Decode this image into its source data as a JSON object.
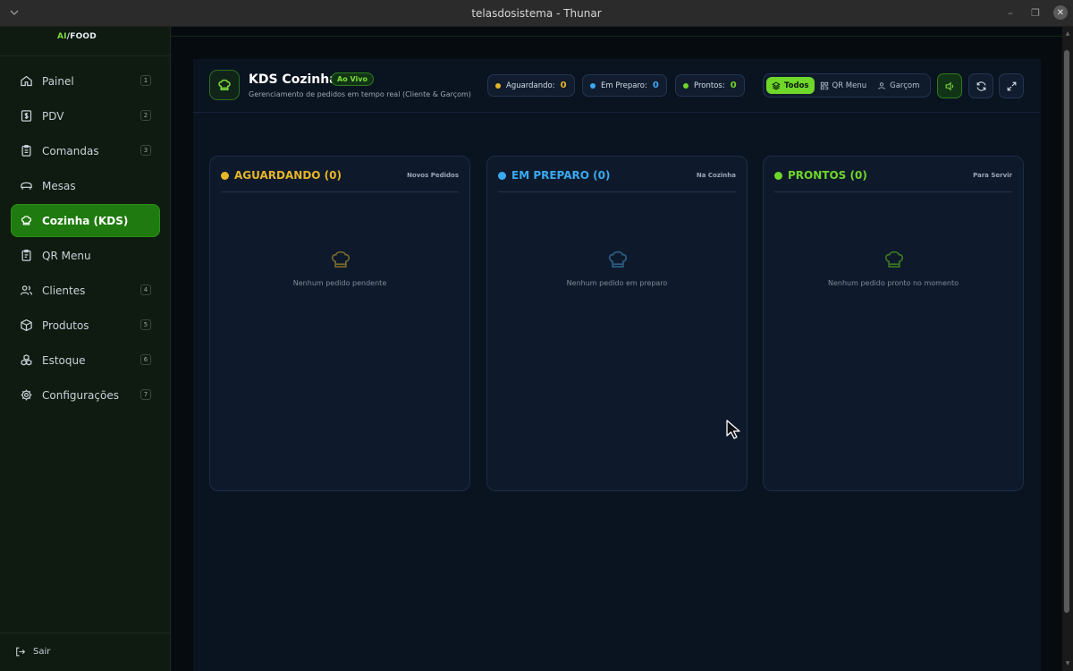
{
  "window": {
    "title": "telasdosistema - Thunar",
    "minimize": "–",
    "maximize": "❐",
    "close": "✕"
  },
  "sidebar": {
    "brand": {
      "ai": "AI",
      "food": "FOOD"
    },
    "items": [
      {
        "label": "Painel",
        "icon": "home-icon",
        "key": "1"
      },
      {
        "label": "PDV",
        "icon": "dollar-icon",
        "key": "2"
      },
      {
        "label": "Comandas",
        "icon": "clipboard-icon",
        "key": "3"
      },
      {
        "label": "Mesas",
        "icon": "table-icon",
        "key": ""
      },
      {
        "label": "Cozinha (KDS)",
        "icon": "chef-hat-icon",
        "key": "",
        "active": true
      },
      {
        "label": "QR Menu",
        "icon": "qr-doc-icon",
        "key": ""
      },
      {
        "label": "Clientes",
        "icon": "users-icon",
        "key": "4"
      },
      {
        "label": "Produtos",
        "icon": "box-icon",
        "key": "5"
      },
      {
        "label": "Estoque",
        "icon": "boxes-icon",
        "key": "6"
      },
      {
        "label": "Configurações",
        "icon": "gear-icon",
        "key": "7"
      }
    ],
    "logout": "Sair"
  },
  "header": {
    "title": "KDS Cozinha",
    "live_badge": "Ao Vivo",
    "subtitle": "Gerenciamento de pedidos em tempo real (Cliente & Garçom)",
    "stats": [
      {
        "label": "Aguardando:",
        "value": "0",
        "color": "#e5b52a"
      },
      {
        "label": "Em Preparo:",
        "value": "0",
        "color": "#3aa9f0"
      },
      {
        "label": "Prontos:",
        "value": "0",
        "color": "#6fd62a"
      }
    ],
    "filters": [
      {
        "label": "Todos",
        "icon": "layers-icon",
        "active": true
      },
      {
        "label": "QR Menu",
        "icon": "qr-icon",
        "active": false
      },
      {
        "label": "Garçom",
        "icon": "user-icon",
        "active": false
      }
    ]
  },
  "columns": [
    {
      "title": "AGUARDANDO (0)",
      "tag": "Novos Pedidos",
      "empty": "Nenhum pedido pendente",
      "color": "#e5b52a"
    },
    {
      "title": "EM PREPARO (0)",
      "tag": "Na Cozinha",
      "empty": "Nenhum pedido em preparo",
      "color": "#3aa9f0"
    },
    {
      "title": "PRONTOS (0)",
      "tag": "Para Servir",
      "empty": "Nenhum pedido pronto no momento",
      "color": "#6fd62a"
    }
  ]
}
